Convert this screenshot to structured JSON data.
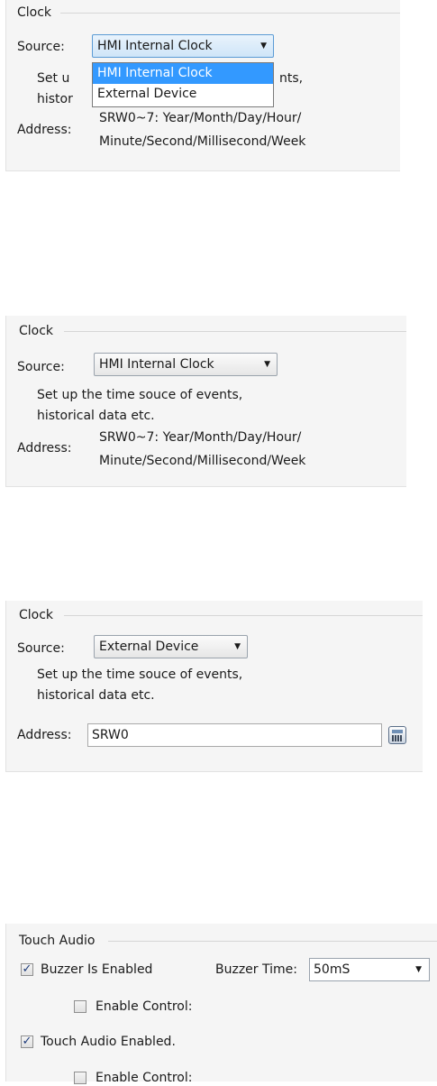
{
  "clock_panel_1": {
    "group_title": "Clock",
    "source_label": "Source:",
    "source_value": "HMI Internal Clock",
    "dropdown_options": [
      "HMI Internal Clock",
      "External Device"
    ],
    "desc_line1_visible_start": "Set u",
    "desc_line1_visible_end": "nts,",
    "desc_line2_visible_start": "histor",
    "address_label": "Address:",
    "address_line1": "SRW0~7: Year/Month/Day/Hour/",
    "address_line2": "Minute/Second/Millisecond/Week"
  },
  "clock_panel_2": {
    "group_title": "Clock",
    "source_label": "Source:",
    "source_value": "HMI Internal Clock",
    "desc_line1": "Set up the time souce of events,",
    "desc_line2": "historical data etc.",
    "address_label": "Address:",
    "address_line1": "SRW0~7: Year/Month/Day/Hour/",
    "address_line2": "Minute/Second/Millisecond/Week"
  },
  "clock_panel_3": {
    "group_title": "Clock",
    "source_label": "Source:",
    "source_value": "External Device",
    "desc_line1": "Set up the time souce of events,",
    "desc_line2": "historical data etc.",
    "address_label": "Address:",
    "address_value": "SRW0"
  },
  "touch_audio_panel": {
    "group_title": "Touch Audio",
    "buzzer_enabled_label": "Buzzer Is Enabled",
    "buzzer_enabled_checked": true,
    "buzzer_time_label": "Buzzer Time:",
    "buzzer_time_value": "50mS",
    "enable_control_label_1": "Enable Control:",
    "enable_control_checked_1": false,
    "touch_audio_enabled_label": "Touch Audio Enabled.",
    "touch_audio_enabled_checked": true,
    "enable_control_label_2": "Enable Control:",
    "enable_control_checked_2": false
  },
  "icons": {
    "dropdown_arrow": "▼",
    "checkmark": "✓"
  }
}
